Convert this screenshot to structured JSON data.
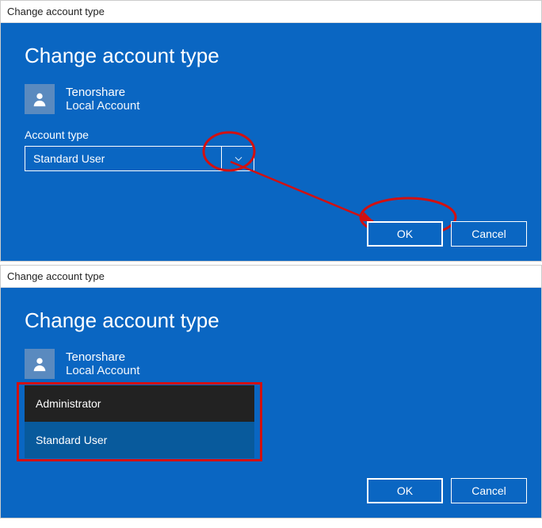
{
  "window1": {
    "title": "Change account type",
    "panelTitle": "Change account type",
    "account": {
      "name": "Tenorshare",
      "status": "Local Account"
    },
    "fieldLabel": "Account type",
    "selectedValue": "Standard User",
    "buttons": {
      "ok": "OK",
      "cancel": "Cancel"
    }
  },
  "window2": {
    "title": "Change account type",
    "panelTitle": "Change account type",
    "account": {
      "name": "Tenorshare",
      "status": "Local Account"
    },
    "dropdownOptions": {
      "administrator": "Administrator",
      "standardUser": "Standard User"
    },
    "buttons": {
      "ok": "OK",
      "cancel": "Cancel"
    }
  }
}
